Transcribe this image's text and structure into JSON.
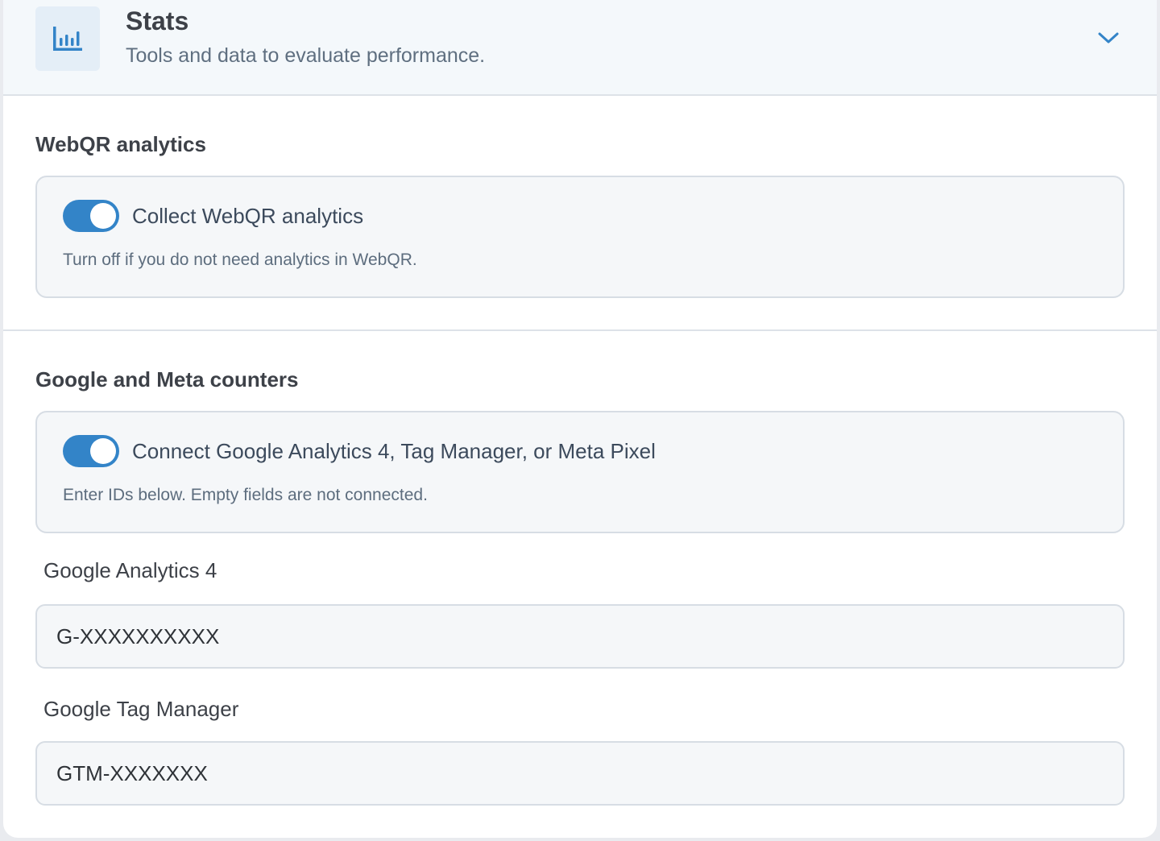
{
  "header": {
    "icon": "bar-chart-icon",
    "title": "Stats",
    "subtitle": "Tools and data to evaluate performance.",
    "expand_icon": "chevron-down-icon"
  },
  "webqr": {
    "heading": "WebQR analytics",
    "toggle_on": true,
    "toggle_label": "Collect WebQR analytics",
    "description": "Turn off if you do not need analytics in WebQR."
  },
  "counters": {
    "heading": "Google and Meta counters",
    "toggle_on": true,
    "toggle_label": "Connect Google Analytics 4, Tag Manager, or Meta Pixel",
    "description": "Enter IDs below. Empty fields are not connected."
  },
  "fields": {
    "ga4": {
      "label": "Google Analytics 4",
      "placeholder": "G-XXXXXXXXXX"
    },
    "gtm": {
      "label": "Google Tag Manager",
      "placeholder": "GTM-XXXXXXX"
    }
  },
  "colors": {
    "accent": "#3384c8",
    "header_bg": "#f4f8fb",
    "card_bg": "#f5f7f9"
  }
}
